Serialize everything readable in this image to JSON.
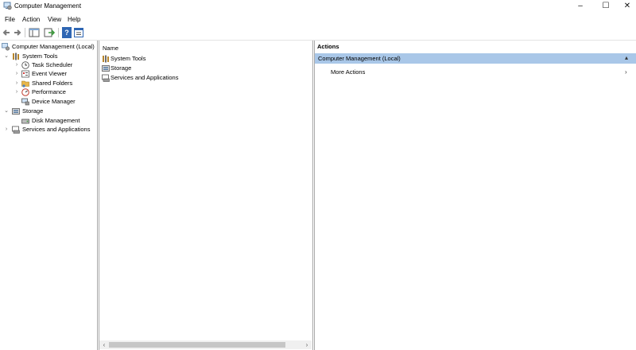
{
  "window": {
    "title": "Computer Management",
    "minimize_glyph": "–",
    "maximize_glyph": "☐",
    "close_glyph": "✕"
  },
  "menu": [
    "File",
    "Action",
    "View",
    "Help"
  ],
  "toolbar": {
    "icons": [
      "back-icon",
      "forward-icon",
      "show-hide-console-tree-icon",
      "export-list-icon",
      "help-icon",
      "properties-icon"
    ],
    "help_glyph": "?"
  },
  "tree": {
    "root": "Computer Management (Local)",
    "system_tools": "System Tools",
    "task_scheduler": "Task Scheduler",
    "event_viewer": "Event Viewer",
    "shared_folders": "Shared Folders",
    "performance": "Performance",
    "device_manager": "Device Manager",
    "storage": "Storage",
    "disk_management": "Disk Management",
    "services_apps": "Services and Applications",
    "collapse_glyph": "⌄",
    "expand_glyph": "›"
  },
  "list": {
    "header": "Name",
    "items": [
      "System Tools",
      "Storage",
      "Services and Applications"
    ],
    "scroll_left": "‹",
    "scroll_right": "›"
  },
  "actions": {
    "header": "Actions",
    "selected": "Computer Management (Local)",
    "more": "More Actions",
    "more_arrow": "›"
  },
  "colors": {
    "selection": "#a9c7e8",
    "pane_border": "#a9a9a9"
  }
}
